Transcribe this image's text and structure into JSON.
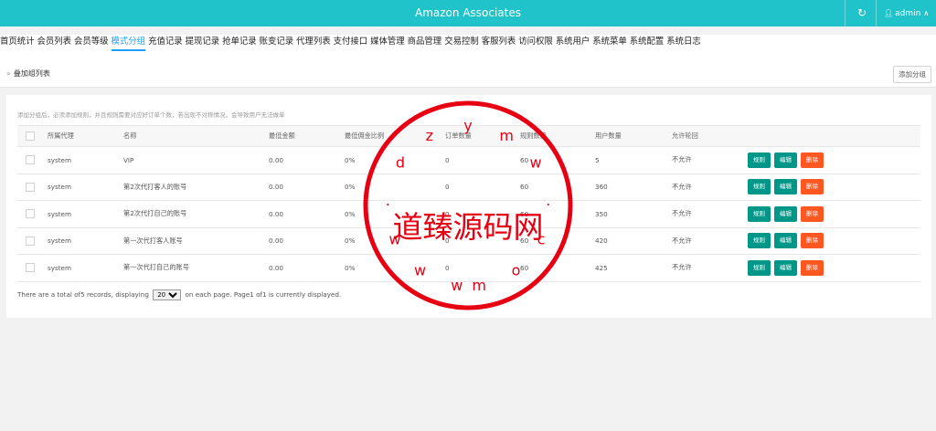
{
  "app": {
    "title": "Amazon Associates",
    "refresh_icon": "refresh-icon",
    "user_name": "admin",
    "user_icon": "user-icon",
    "caret_icon": "chevron-up-icon"
  },
  "nav": {
    "items": [
      "首页统计",
      "会员列表",
      "会员等级",
      "模式分组",
      "充值记录",
      "提现记录",
      "抢单记录",
      "账变记录",
      "代理列表",
      "支付接口",
      "媒体管理",
      "商品管理",
      "交易控制",
      "客服列表",
      "访问权限",
      "系统用户",
      "系统菜单",
      "系统配置",
      "系统日志"
    ],
    "active": "模式分组"
  },
  "breadcrumb": {
    "text": "叠加组列表",
    "arrow": "»"
  },
  "add_button": "添加分组",
  "tip": "添加分组后，必须添加规则，并且规则需要对应好订单个数，若出现不对称情况，会导致用户无法做单",
  "table": {
    "headers": [
      "所属代理",
      "名称",
      "最低金额",
      "最低佣金比例",
      "订单数量",
      "规则数量",
      "用户数量",
      "允许轮回"
    ],
    "rows": [
      [
        "system",
        "VIP",
        "0.00",
        "0%",
        "0",
        "60",
        "5",
        "不允许"
      ],
      [
        "system",
        "第2次代打客人的账号",
        "0.00",
        "0%",
        "0",
        "60",
        "360",
        "不允许"
      ],
      [
        "system",
        "第2次代打自己的账号",
        "0.00",
        "0%",
        "0",
        "60",
        "350",
        "不允许"
      ],
      [
        "system",
        "第一次代打客人账号",
        "0.00",
        "0%",
        "0",
        "60",
        "420",
        "不允许"
      ],
      [
        "system",
        "第一次代打自己的账号",
        "0.00",
        "0%",
        "0",
        "60",
        "425",
        "不允许"
      ]
    ],
    "actions": [
      "规则",
      "编辑",
      "删除"
    ]
  },
  "pager": {
    "before": "There are a total of5 records, displaying",
    "page_size": "20",
    "after": "on each page. Page1 of1 is currently displayed."
  },
  "watermark": {
    "center_text": "道臻源码网",
    "ring_text": "w w w . d z y m w . c o m",
    "color": "#e60012"
  },
  "colors": {
    "topbar": "#1fc3c9",
    "active_nav": "#1e9fff",
    "teal_button": "#009688",
    "orange_button": "#ff5722"
  }
}
